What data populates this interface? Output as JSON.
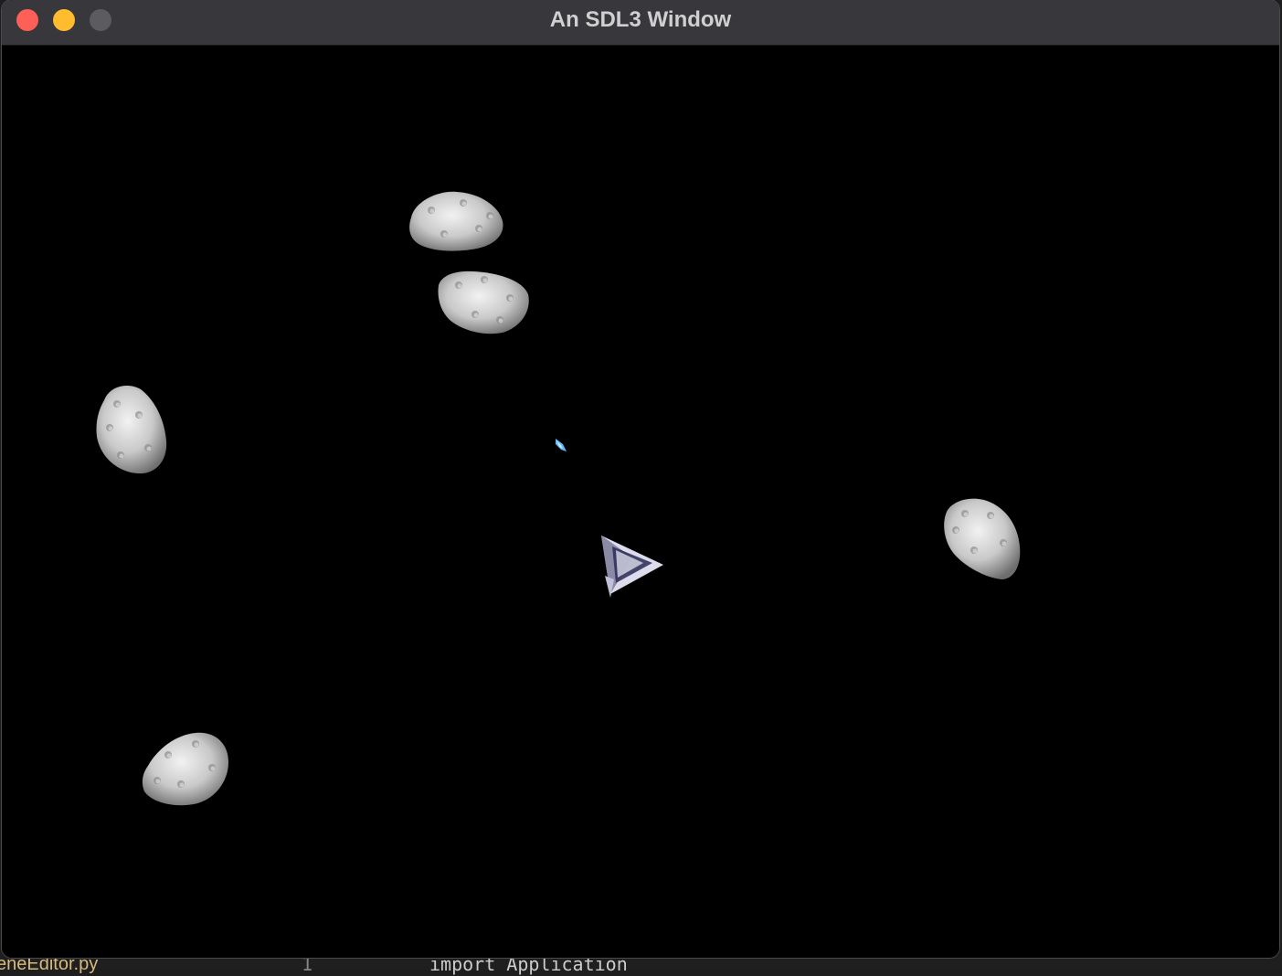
{
  "window": {
    "title": "An SDL3 Window",
    "traffic_lights": {
      "close_color": "#fe5f57",
      "minimize_color": "#febc2e",
      "zoom_color": "#5c5b5f"
    }
  },
  "game": {
    "background_color": "#000000",
    "asteroid_count": 5,
    "player": {
      "icon": "spaceship-icon"
    },
    "projectile": {
      "icon": "laser-bolt-icon",
      "color": "#5fb8ff"
    }
  },
  "background_editor": {
    "file_fragment": "eneEditor.py",
    "line_number": "1",
    "code_fragment": "import Application"
  }
}
